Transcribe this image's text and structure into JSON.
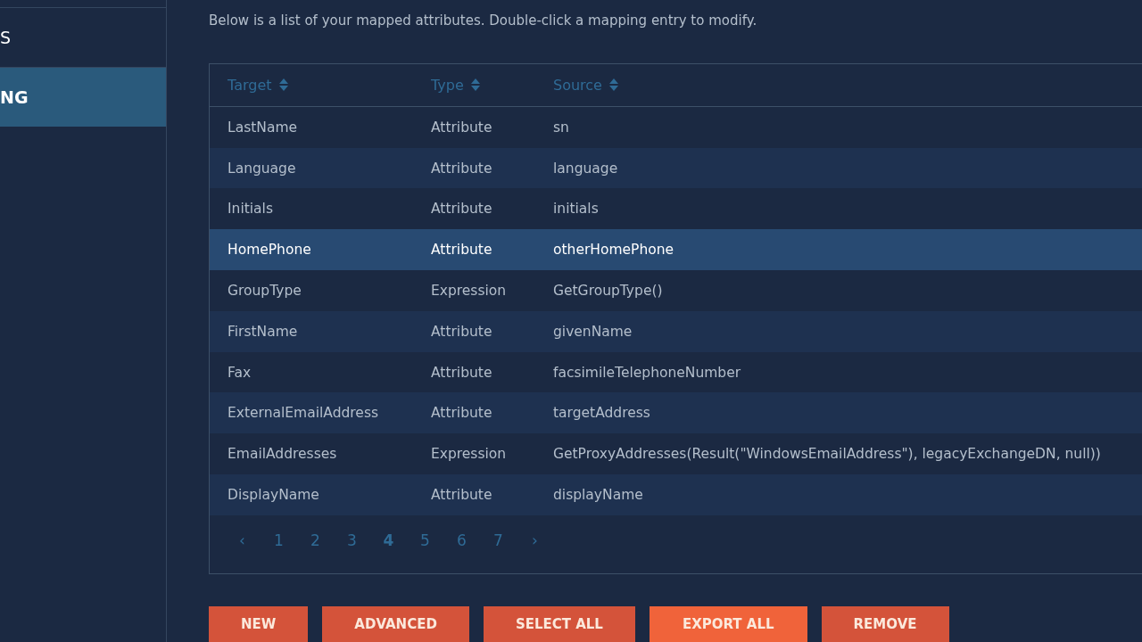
{
  "sidebar": {
    "items": [
      {
        "label": "S",
        "selected": false
      },
      {
        "label": "NG",
        "selected": true
      }
    ]
  },
  "description": "Below is a list of your mapped attributes. Double-click a mapping entry to modify.",
  "table": {
    "columns": [
      "Target",
      "Type",
      "Source"
    ],
    "rows": [
      {
        "cells": [
          "LastName",
          "Attribute",
          "sn"
        ],
        "selected": false
      },
      {
        "cells": [
          "Language",
          "Attribute",
          "language"
        ],
        "selected": false
      },
      {
        "cells": [
          "Initials",
          "Attribute",
          "initials"
        ],
        "selected": false
      },
      {
        "cells": [
          "HomePhone",
          "Attribute",
          "otherHomePhone"
        ],
        "selected": true
      },
      {
        "cells": [
          "GroupType",
          "Expression",
          "GetGroupType()"
        ],
        "selected": false
      },
      {
        "cells": [
          "FirstName",
          "Attribute",
          "givenName"
        ],
        "selected": false
      },
      {
        "cells": [
          "Fax",
          "Attribute",
          "facsimileTelephoneNumber"
        ],
        "selected": false
      },
      {
        "cells": [
          "ExternalEmailAddress",
          "Attribute",
          "targetAddress"
        ],
        "selected": false
      },
      {
        "cells": [
          "EmailAddresses",
          "Expression",
          "GetProxyAddresses(Result(\"WindowsEmailAddress\"), legacyExchangeDN, null))"
        ],
        "selected": false
      },
      {
        "cells": [
          "DisplayName",
          "Attribute",
          "displayName"
        ],
        "selected": false
      }
    ]
  },
  "pagination": {
    "prev": "‹",
    "next": "›",
    "pages": [
      {
        "label": "1",
        "selected": false
      },
      {
        "label": "2",
        "selected": false
      },
      {
        "label": "3",
        "selected": false
      },
      {
        "label": "4",
        "selected": true
      },
      {
        "label": "5",
        "selected": false
      },
      {
        "label": "6",
        "selected": false
      },
      {
        "label": "7",
        "selected": false
      }
    ]
  },
  "buttons": [
    {
      "label": "NEW",
      "hovered": false
    },
    {
      "label": "ADVANCED",
      "hovered": false
    },
    {
      "label": "SELECT ALL",
      "hovered": false
    },
    {
      "label": "EXPORT ALL",
      "hovered": true
    },
    {
      "label": "REMOVE",
      "hovered": false
    }
  ]
}
